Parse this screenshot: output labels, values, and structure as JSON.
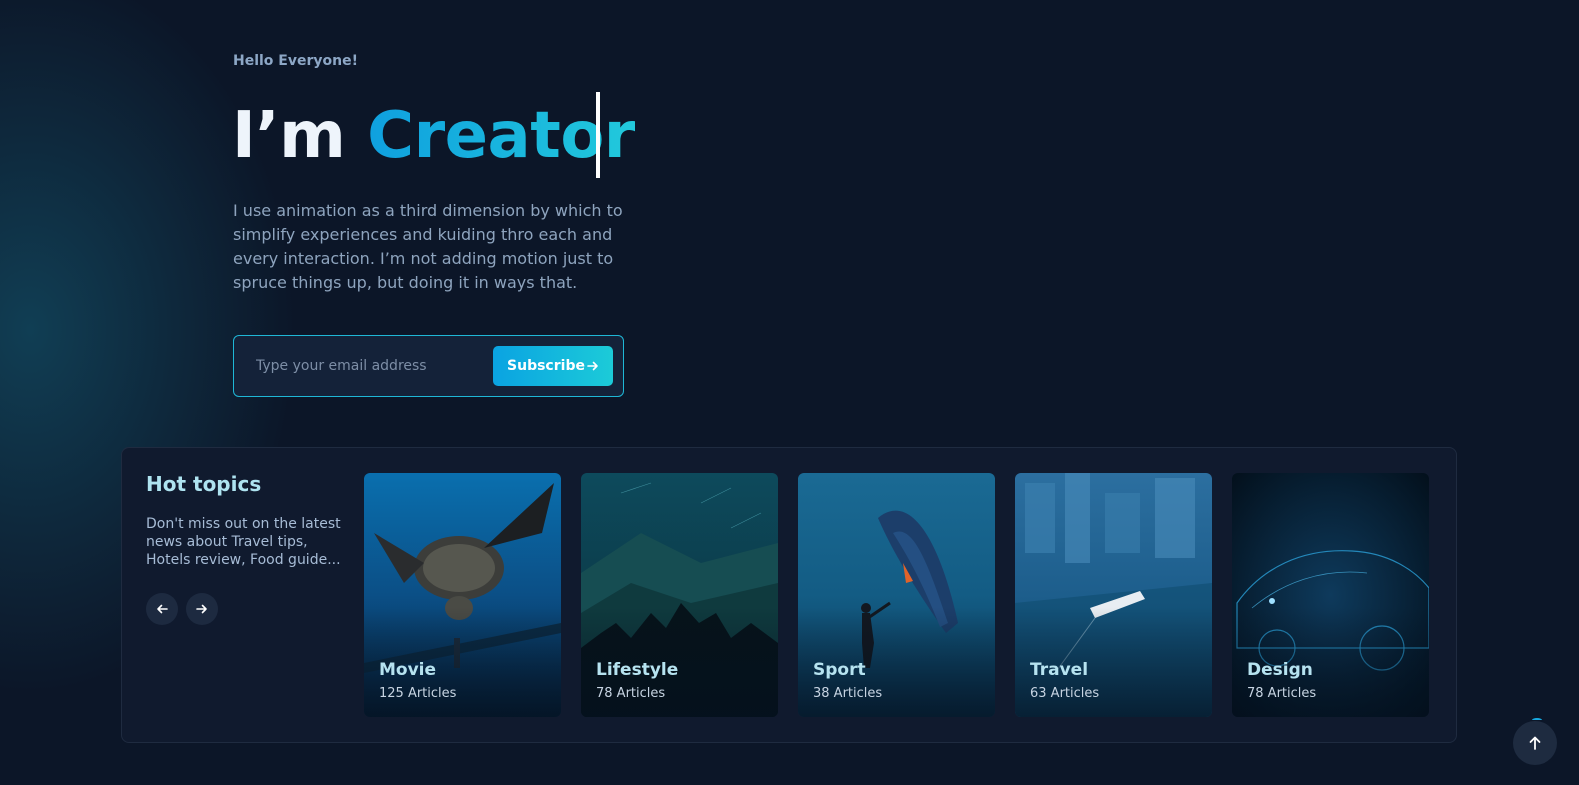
{
  "hero": {
    "greeting": "Hello Everyone!",
    "title_prefix": "I’m",
    "title_accent": "Creator",
    "bio": "I use animation as a third dimension by which to simplify experiences and kuiding thro each and every interaction. I’m not adding motion just to spruce things up, but doing it in ways that."
  },
  "subscribe": {
    "placeholder": "Type your email address",
    "value": "",
    "button_label": "Subscribe",
    "button_icon": "arrow-right-icon"
  },
  "topics": {
    "title": "Hot topics",
    "description": "Don't miss out on the latest news about Travel tips, Hotels review, Food guide...",
    "prev_icon": "arrow-left-icon",
    "next_icon": "arrow-right-icon",
    "cards": [
      {
        "name": "Movie",
        "count": "125 Articles"
      },
      {
        "name": "Lifestyle",
        "count": "78 Articles"
      },
      {
        "name": "Sport",
        "count": "38 Articles"
      },
      {
        "name": "Travel",
        "count": "63 Articles"
      },
      {
        "name": "Design",
        "count": "78 Articles"
      }
    ]
  },
  "scroll_top": {
    "icon": "arrow-up-icon"
  },
  "colors": {
    "background": "#0c1628",
    "accent_start": "#0fa0df",
    "accent_end": "#22c9dc",
    "panel": "#101a2e",
    "muted_text": "#8ea4be"
  }
}
